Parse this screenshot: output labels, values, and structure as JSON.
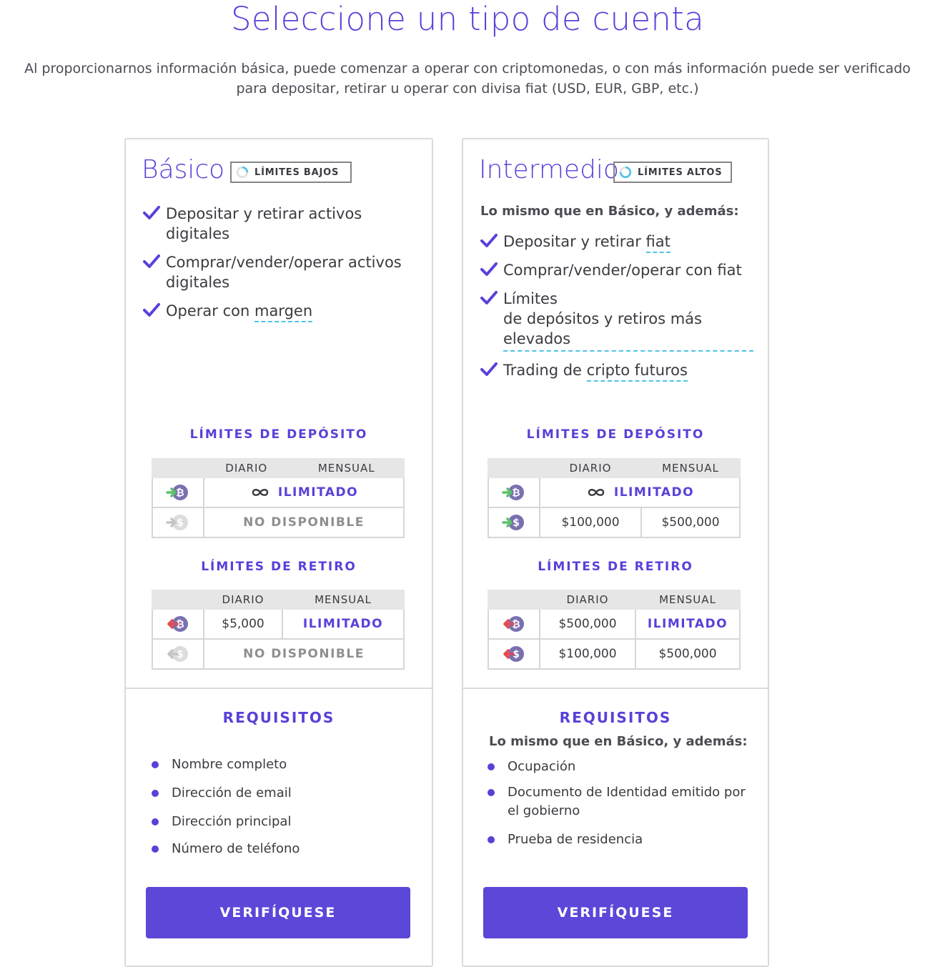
{
  "header": {
    "title": "Seleccione un tipo de cuenta",
    "subtitle": "Al proporcionarnos información básica, puede comenzar a operar con criptomonedas, o con más información puede ser verificado para depositar, retirar u operar con divisa fiat (USD, EUR, GBP, etc.)"
  },
  "colors": {
    "accent": "#5741d9",
    "button": "#5b47d8",
    "dotted_underline": "#4fc3e8",
    "deposit_arrow": "#5cc16a",
    "withdraw_arrow": "#e5484d"
  },
  "basic": {
    "title": "Básico",
    "badge": "LÍMITES BAJOS",
    "badge_level": 0.25,
    "features": [
      {
        "text": "Depositar y retirar activos digitales",
        "link": ""
      },
      {
        "text": "Comprar/vender/operar activos digitales",
        "link": ""
      },
      {
        "text": "Operar con ",
        "link": "margen"
      }
    ],
    "deposit_title": "LÍMITES DE DEPÓSITO",
    "deposit_cols": [
      "DIARIO",
      "MENSUAL"
    ],
    "deposit_crypto": "ILIMITADO",
    "deposit_fiat": "NO DISPONIBLE",
    "withdraw_title": "LÍMITES DE RETIRO",
    "withdraw_cols": [
      "DIARIO",
      "MENSUAL"
    ],
    "withdraw_crypto_daily": "$5,000",
    "withdraw_crypto_monthly": "ILIMITADO",
    "withdraw_fiat": "NO DISPONIBLE",
    "req_title": "REQUISITOS",
    "requirements": [
      "Nombre completo",
      "Dirección de email",
      "Dirección principal",
      "Número de teléfono"
    ],
    "button": "VERIFÍQUESE"
  },
  "intermediate": {
    "title": "Intermedio",
    "badge": "LÍMITES ALTOS",
    "badge_level": 0.75,
    "same_as": "Lo mismo que en Básico, y además:",
    "features": [
      {
        "text": "Depositar y retirar ",
        "link": "fiat"
      },
      {
        "text": "Comprar/vender/operar con fiat",
        "link": ""
      },
      {
        "text": "Límites",
        "link": "de depósitos y retiros más elevados"
      },
      {
        "text": "Trading de ",
        "link": "cripto futuros"
      }
    ],
    "deposit_title": "LÍMITES DE DEPÓSITO",
    "deposit_cols": [
      "DIARIO",
      "MENSUAL"
    ],
    "deposit_crypto": "ILIMITADO",
    "deposit_fiat_daily": "$100,000",
    "deposit_fiat_monthly": "$500,000",
    "withdraw_title": "LÍMITES DE RETIRO",
    "withdraw_cols": [
      "DIARIO",
      "MENSUAL"
    ],
    "withdraw_crypto_daily": "$500,000",
    "withdraw_crypto_monthly": "ILIMITADO",
    "withdraw_fiat_daily": "$100,000",
    "withdraw_fiat_monthly": "$500,000",
    "req_title": "REQUISITOS",
    "req_same": "Lo mismo que en Básico, y además:",
    "requirements": [
      "Ocupación",
      "Documento de Identidad emitido por el gobierno",
      "Prueba de residencia"
    ],
    "button": "VERIFÍQUESE"
  }
}
